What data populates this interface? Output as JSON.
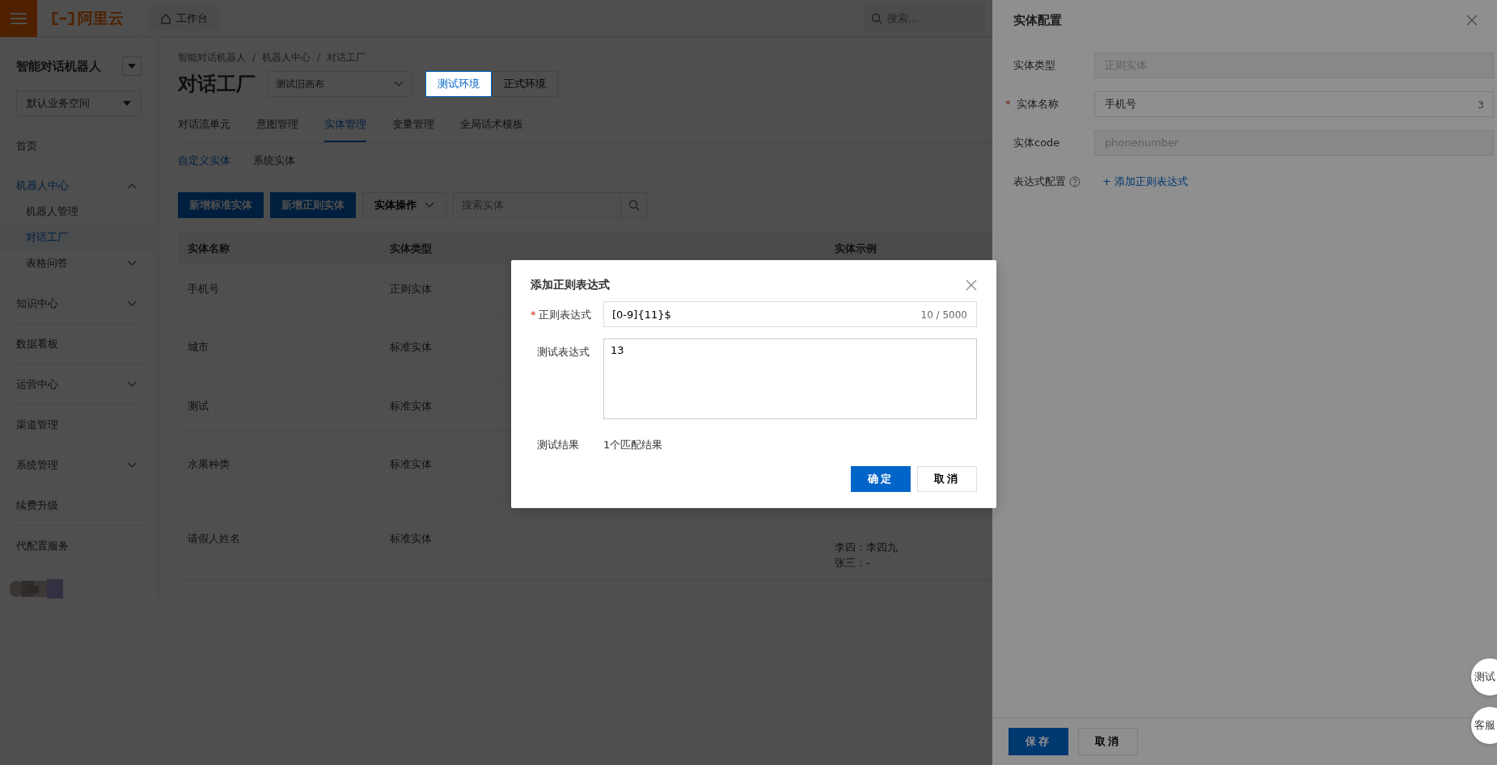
{
  "header": {
    "logo_text": "阿里云",
    "workbench": "工作台",
    "search_placeholder": "搜索..."
  },
  "sidebar": {
    "title": "智能对话机器人",
    "workspace": "默认业务空间",
    "items": [
      {
        "label": "首页",
        "selected": false
      },
      {
        "label": "机器人中心",
        "selected": false,
        "expanded": true,
        "children": [
          {
            "label": "机器人管理",
            "selected": false
          },
          {
            "label": "对话工厂",
            "selected": true
          },
          {
            "label": "表格问答",
            "selected": false,
            "expanded": false
          }
        ]
      },
      {
        "label": "知识中心",
        "selected": false,
        "expanded": false
      },
      {
        "label": "数据看板",
        "selected": false
      },
      {
        "label": "运营中心",
        "selected": false,
        "expanded": false
      },
      {
        "label": "渠道管理",
        "selected": false
      },
      {
        "label": "系统管理",
        "selected": false,
        "expanded": false
      },
      {
        "label": "续费升级",
        "selected": false
      },
      {
        "label": "代配置服务",
        "selected": false
      }
    ]
  },
  "main": {
    "breadcrumb": [
      "智能对话机器人",
      "机器人中心",
      "对话工厂"
    ],
    "breadcrumb_separators": [
      "/",
      "/"
    ],
    "title": "对话工厂",
    "canvas_select": "测试旧画布",
    "environments": [
      {
        "label": "测试环境",
        "selected": true
      },
      {
        "label": "正式环境",
        "selected": false
      }
    ],
    "tabs": [
      {
        "label": "对话流单元",
        "selected": false
      },
      {
        "label": "意图管理",
        "selected": false
      },
      {
        "label": "实体管理",
        "selected": true
      },
      {
        "label": "变量管理",
        "selected": false
      },
      {
        "label": "全局话术模板",
        "selected": false
      }
    ],
    "subtabs": [
      {
        "label": "自定义实体",
        "selected": true
      },
      {
        "label": "系统实体",
        "selected": false
      }
    ],
    "toolbar": {
      "buttons": [
        "新增标准实体",
        "新增正则实体"
      ],
      "menu": "实体操作",
      "search_placeholder": "搜索实体"
    },
    "table": {
      "columns": [
        "实体名称",
        "实体类型",
        "实体示例"
      ],
      "rows": [
        {
          "name": "手机号",
          "type": "正则实体",
          "examples": []
        },
        {
          "name": "城市",
          "type": "标准实体",
          "examples": []
        },
        {
          "name": "测试",
          "type": "标准实体",
          "examples": []
        },
        {
          "name": "水果种类",
          "type": "标准实体",
          "examples": []
        },
        {
          "name": "请假人姓名",
          "type": "标准实体",
          "examples": [
            "李四：李四九",
            "张三：-"
          ]
        }
      ]
    }
  },
  "drawer": {
    "title": "实体配置",
    "fields": [
      {
        "kind": "input",
        "label": "实体类型",
        "value": "正则实体",
        "disabled": true
      },
      {
        "kind": "input",
        "label": "实体名称",
        "value": "手机号",
        "counter": "3",
        "required_mark": "*",
        "disabled": false
      },
      {
        "kind": "input",
        "label": "实体code",
        "value": "phonenumber",
        "disabled": true
      },
      {
        "kind": "link",
        "label": "表达式配置",
        "link": "+ 添加正则表达式"
      }
    ],
    "buttons": [
      {
        "label": "保存",
        "primary": true
      },
      {
        "label": "取消",
        "primary": false
      }
    ]
  },
  "modal": {
    "title": "添加正则表达式",
    "regex": {
      "label": "正则表达式",
      "required_mark": "*",
      "value": "[0-9]{11}$",
      "counter": "10 / 5000"
    },
    "test": {
      "label": "测试表达式",
      "value": "13"
    },
    "result": {
      "label": "测试结果",
      "value": "1个匹配结果"
    },
    "buttons": [
      {
        "label": "确定",
        "primary": true
      },
      {
        "label": "取消",
        "primary": false
      }
    ]
  },
  "float_buttons": [
    "测试",
    "客服"
  ]
}
